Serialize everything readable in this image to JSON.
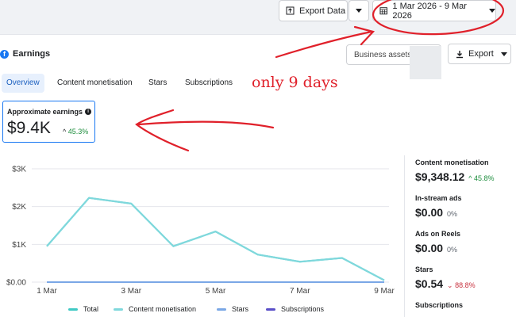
{
  "toolbar": {
    "export_data_label": "Export Data",
    "date_range_label": "1 Mar 2026 - 9 Mar 2026"
  },
  "header": {
    "title": "Earnings",
    "business_assets_label": "Business assets:",
    "export_label": "Export"
  },
  "tabs": [
    {
      "label": "Overview",
      "active": true
    },
    {
      "label": "Content monetisation",
      "active": false
    },
    {
      "label": "Stars",
      "active": false
    },
    {
      "label": "Subscriptions",
      "active": false
    }
  ],
  "summary_card": {
    "label": "Approximate earnings",
    "value": "$9.4K",
    "change": "45.3%"
  },
  "chart_data": {
    "type": "line",
    "x": [
      "1 Mar",
      "2 Mar",
      "3 Mar",
      "4 Mar",
      "5 Mar",
      "6 Mar",
      "7 Mar",
      "8 Mar",
      "9 Mar"
    ],
    "x_tick_labels": [
      "1 Mar",
      "3 Mar",
      "5 Mar",
      "7 Mar",
      "9 Mar"
    ],
    "y_tick_labels": [
      "$0.00",
      "$1K",
      "$2K",
      "$3K"
    ],
    "ylim": [
      0,
      3000
    ],
    "grid": true,
    "legend_position": "bottom",
    "series": [
      {
        "name": "Total",
        "color": "#3fc9c4",
        "values": [
          950,
          2230,
          2080,
          950,
          1340,
          730,
          540,
          640,
          50
        ]
      },
      {
        "name": "Content monetisation",
        "color": "#7fd8dc",
        "values": [
          950,
          2230,
          2080,
          950,
          1340,
          730,
          540,
          640,
          50
        ]
      },
      {
        "name": "Stars",
        "color": "#7aa7e6",
        "values": [
          0,
          0,
          0,
          0,
          0,
          0,
          0,
          0,
          0
        ]
      },
      {
        "name": "Subscriptions",
        "color": "#5a4fc8",
        "values": [
          0,
          0,
          0,
          0,
          0,
          0,
          0,
          0,
          0
        ]
      }
    ]
  },
  "metrics": [
    {
      "label": "Content monetisation",
      "value": "$9,348.12",
      "change": "45.8%",
      "direction": "up"
    },
    {
      "label": "In-stream ads",
      "value": "$0.00",
      "change": "0%",
      "direction": "none"
    },
    {
      "label": "Ads on Reels",
      "value": "$0.00",
      "change": "0%",
      "direction": "none"
    },
    {
      "label": "Stars",
      "value": "$0.54",
      "change": "88.8%",
      "direction": "down"
    },
    {
      "label": "Subscriptions",
      "value": "",
      "change": "",
      "direction": "none"
    }
  ],
  "annotation": {
    "text": "only 9 days",
    "color": "#e0202a"
  }
}
